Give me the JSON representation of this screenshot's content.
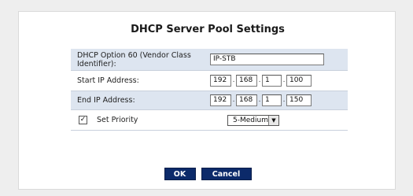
{
  "page": {
    "title": "DHCP Server Pool Settings"
  },
  "form": {
    "vendor_class": {
      "label": "DHCP Option 60 (Vendor Class Identifier):",
      "value": "IP-STB"
    },
    "start_ip": {
      "label": "Start IP Address:",
      "octets": [
        "192",
        "168",
        "1",
        "100"
      ]
    },
    "end_ip": {
      "label": "End IP Address:",
      "octets": [
        "192",
        "168",
        "1",
        "150"
      ]
    },
    "priority": {
      "checked": true,
      "check_glyph": "✓",
      "label": "Set Priority",
      "selected": "5-Medium",
      "arrow_icon": "triangle-down-icon"
    }
  },
  "buttons": {
    "ok_label": "OK",
    "cancel_label": "Cancel"
  },
  "colors": {
    "button_bg": "#0c2a6a",
    "row_shade": "#dde5f0"
  }
}
